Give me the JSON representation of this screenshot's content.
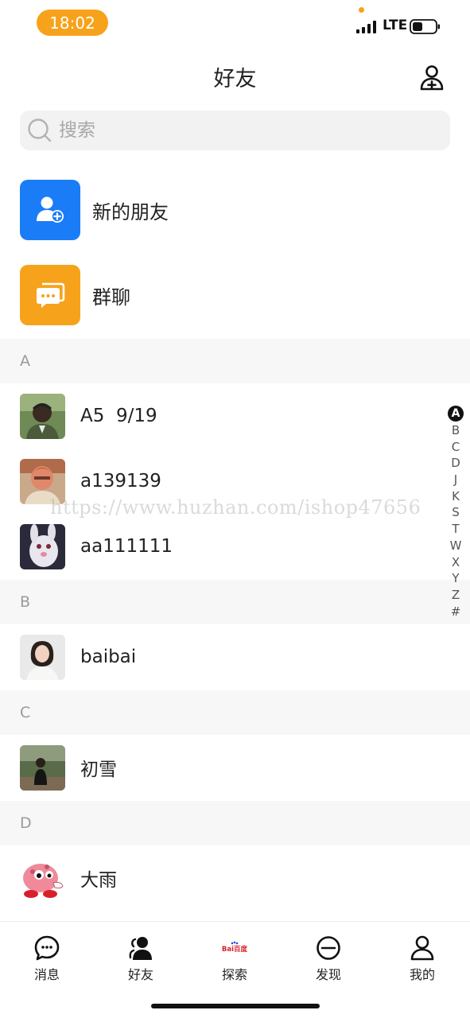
{
  "status_bar": {
    "time": "18:02",
    "network": "LTE"
  },
  "header": {
    "title": "好友"
  },
  "search": {
    "placeholder": "搜索"
  },
  "entries": [
    {
      "label": "新的朋友",
      "icon": "new-friend-icon",
      "color": "#1a7cf7"
    },
    {
      "label": "群聊",
      "icon": "group-chat-icon",
      "color": "#f7a21b"
    }
  ],
  "sections": [
    {
      "letter": "A",
      "contacts": [
        {
          "name": "A5  9/19"
        },
        {
          "name": "a139139"
        },
        {
          "name": "aa111111"
        }
      ]
    },
    {
      "letter": "B",
      "contacts": [
        {
          "name": "baibai"
        }
      ]
    },
    {
      "letter": "C",
      "contacts": [
        {
          "name": "初雪"
        }
      ]
    },
    {
      "letter": "D",
      "contacts": [
        {
          "name": "大雨"
        }
      ]
    }
  ],
  "index_bar": {
    "letters": [
      "A",
      "B",
      "C",
      "D",
      "J",
      "K",
      "S",
      "T",
      "W",
      "X",
      "Y",
      "Z",
      "#"
    ],
    "active": "A"
  },
  "watermark": "https://www.huzhan.com/ishop47656",
  "tabs": [
    {
      "label": "消息",
      "icon": "message-icon"
    },
    {
      "label": "好友",
      "icon": "friends-icon",
      "active": true
    },
    {
      "label": "探索",
      "icon": "explore-logo-icon",
      "logo_text": "Bai百度"
    },
    {
      "label": "发现",
      "icon": "discover-icon"
    },
    {
      "label": "我的",
      "icon": "profile-icon"
    }
  ],
  "colors": {
    "accent_blue": "#1a7cf7",
    "accent_orange": "#f7a21b",
    "section_bg": "#f7f7f7"
  }
}
